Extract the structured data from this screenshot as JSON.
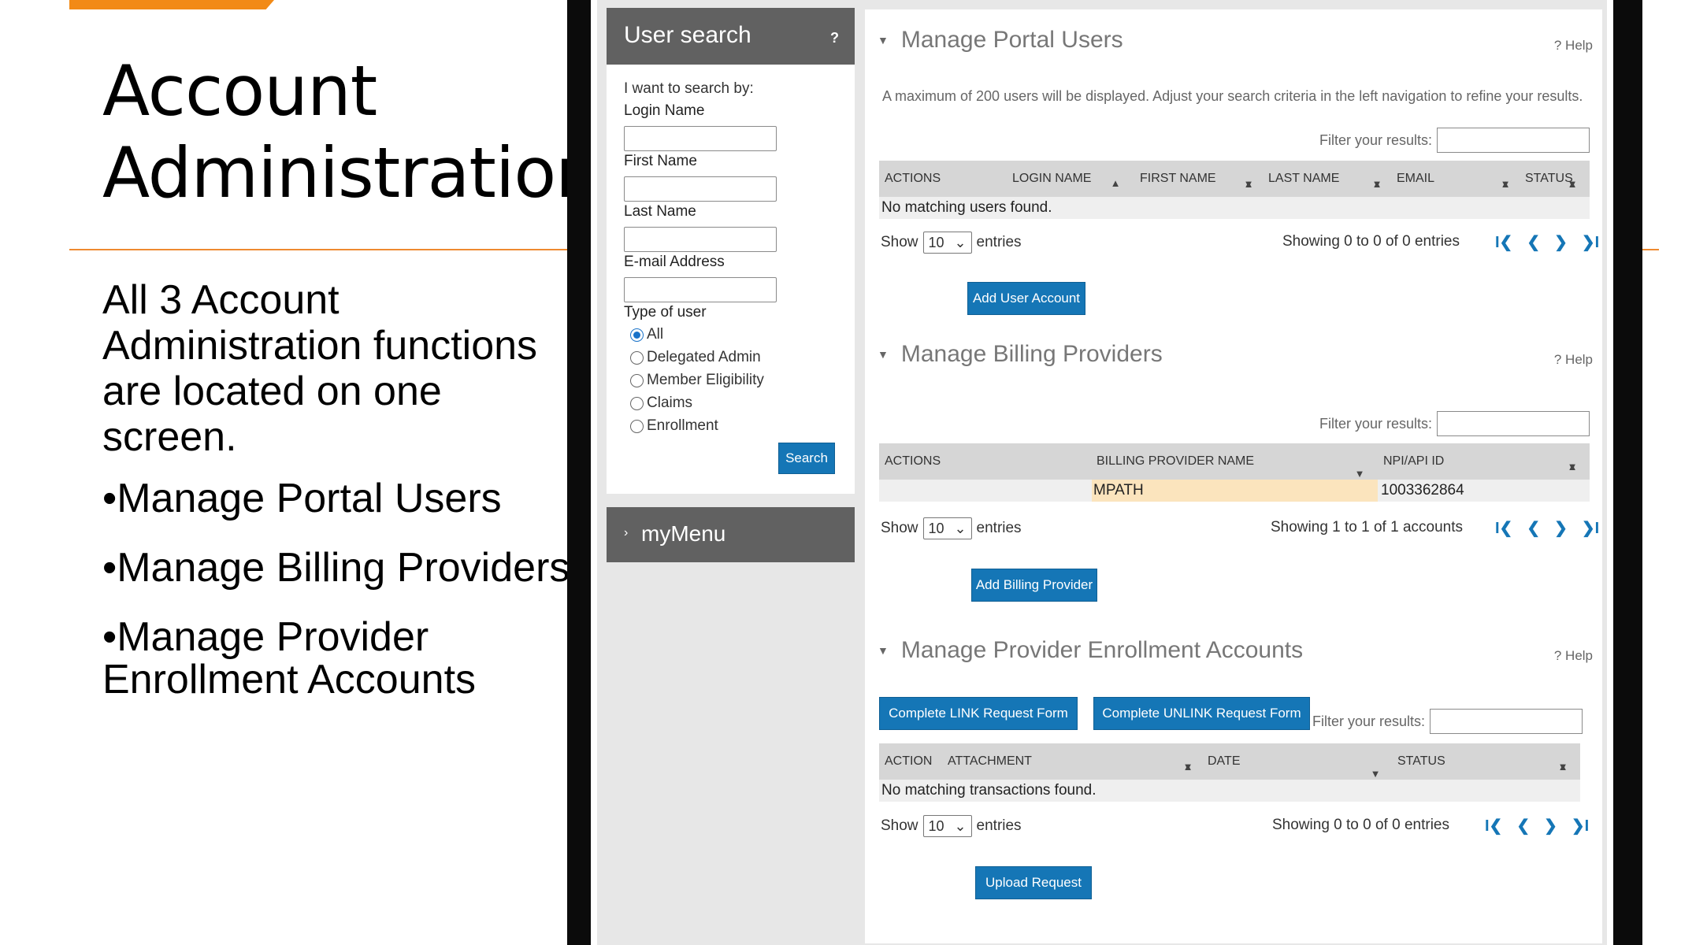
{
  "slide": {
    "title": "Account Administration",
    "intro": "All 3 Account Administration functions are located on one screen.",
    "bullets": [
      "•Manage Portal Users",
      "•Manage Billing Providers",
      "•Manage Provider Enrollment Accounts"
    ]
  },
  "sidebar": {
    "title": "User search",
    "help": "?",
    "prompt": "I want to search by:",
    "fields": [
      "Login Name",
      "First Name",
      "Last Name",
      "E-mail Address"
    ],
    "type_label": "Type of user",
    "types": [
      "All",
      "Delegated Admin",
      "Member Eligibility",
      "Claims",
      "Enrollment"
    ],
    "selected_type": "All",
    "search_button": "Search",
    "menu_arrow": "›",
    "menu_label": "myMenu"
  },
  "portal_users": {
    "title": "Manage Portal Users",
    "help": "? Help",
    "note": "A maximum of 200 users will be displayed. Adjust your search criteria in the left navigation to refine your results.",
    "filter_label": "Filter your results:",
    "columns": [
      "ACTIONS",
      "LOGIN NAME",
      "FIRST NAME",
      "LAST NAME",
      "EMAIL",
      "STATUS"
    ],
    "empty": "No matching users found.",
    "show_label": "Show",
    "page_size": "10",
    "entries_label": "entries",
    "showing": "Showing 0 to 0 of 0 entries",
    "add_button": "Add User Account"
  },
  "billing": {
    "title": "Manage Billing Providers",
    "help": "? Help",
    "filter_label": "Filter your results:",
    "columns": [
      "ACTIONS",
      "BILLING PROVIDER NAME",
      "NPI/API ID"
    ],
    "rows": [
      {
        "name": "MPATH",
        "npi": "1003362864"
      }
    ],
    "highlight_color": "#fbe4bd",
    "show_label": "Show",
    "page_size": "10",
    "entries_label": "entries",
    "showing": "Showing 1 to 1 of 1 accounts",
    "add_button": "Add Billing Provider"
  },
  "enrollment": {
    "title": "Manage Provider Enrollment Accounts",
    "help": "? Help",
    "link_button": "Complete LINK Request Form",
    "unlink_button": "Complete UNLINK Request Form",
    "filter_label": "Filter your results:",
    "columns": [
      "ACTION",
      "ATTACHMENT",
      "DATE",
      "STATUS"
    ],
    "empty": "No matching transactions found.",
    "show_label": "Show",
    "page_size": "10",
    "entries_label": "entries",
    "showing": "Showing 0 to 0 of 0 entries",
    "upload_button": "Upload Request"
  },
  "pager": {
    "first": "I❮",
    "prev": "❮",
    "next": "❯",
    "last": "❯I"
  },
  "colors": {
    "accent": "#f28a16",
    "primary_button": "#1576b6",
    "header_gray": "#616161"
  }
}
